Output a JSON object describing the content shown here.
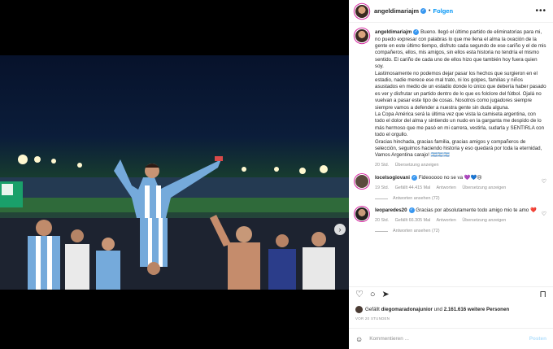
{
  "header": {
    "username": "angeldimariajm",
    "separator": "•",
    "follow_label": "Folgen",
    "more_icon": "ellipsis-icon"
  },
  "caption": {
    "username": "angeldimariajm",
    "lines": [
      "Bueno. llegó el último partido de eliminatorias para mi, no puedo expresar con palabras lo que me llena el alma la ovación de la gente en este último tiempo, disfruto cada segundo de ese cariño y el de mis compañeros, ellos, mis amigos, sin ellos esta historia no tendría el mismo sentido. El cariño de cada uno de ellos hizo que también hoy fuera quien soy.",
      "Lastimosamente no podemos dejar pasar los hechos que surgieron en el estadio, nadie merece ese mal trato, ni los golpes, familias y niños asustados en medio de un estadio donde lo único que debería haber pasado es ver y disfrutar un partido dentro de lo que es folclore del fútbol. Ojalá no vuelvan a pasar este tipo de cosas. Nosotros como jugadores siempre siempre vamos a defender a nuestra gente sin duda alguna.",
      "La Copa América será la última vez que vista la camiseta argentina, con todo el dolor del alma y sintiendo un nudo en la garganta me despido de lo más hermoso que me pasó en mi carrera, vestirla, sudarla y SENTIRLA con todo el orgullo.",
      "Gracias hinchada, gracias familia, gracias amigos y compañeros de selección, seguimos haciendo historia y eso quedará por toda la eternidad, Vamos Argentina carajo! 🇦🇷🇦🇷🇦🇷"
    ],
    "time": "20 Std.",
    "translate": "Übersetzung anzeigen"
  },
  "comments": [
    {
      "username": "locelsogiovani",
      "text": "Fideooooo no se va 💜💙😢",
      "time": "19 Std.",
      "likes": "Gefällt 44.415 Mal",
      "reply": "Antworten",
      "translate": "Übersetzung anzeigen",
      "answers": "Antworten ansehen (72)"
    },
    {
      "username": "leoparedes20",
      "text": "Gracias por absolutamente todo amigo mio te amo ❤️",
      "time": "20 Std.",
      "likes": "Gefällt 66.305 Mal",
      "reply": "Antworten",
      "translate": "Übersetzung anzeigen",
      "answers": "Antworten ansehen (72)"
    }
  ],
  "actions": {
    "like_icon": "heart-icon",
    "comment_icon": "comment-icon",
    "share_icon": "share-icon",
    "save_icon": "bookmark-icon"
  },
  "likes": {
    "prefix": "Gefällt",
    "user": "diegomaradonajunior",
    "and": "und",
    "others": "2.161.616 weitere Personen"
  },
  "posted_ago": "VOR 20 STUNDEN",
  "add_comment": {
    "placeholder": "Kommentieren ...",
    "post_label": "Posten"
  },
  "colors": {
    "link_blue": "#0095f6",
    "verified_blue": "#3897f0",
    "argentina_sky": "#75aadb"
  }
}
